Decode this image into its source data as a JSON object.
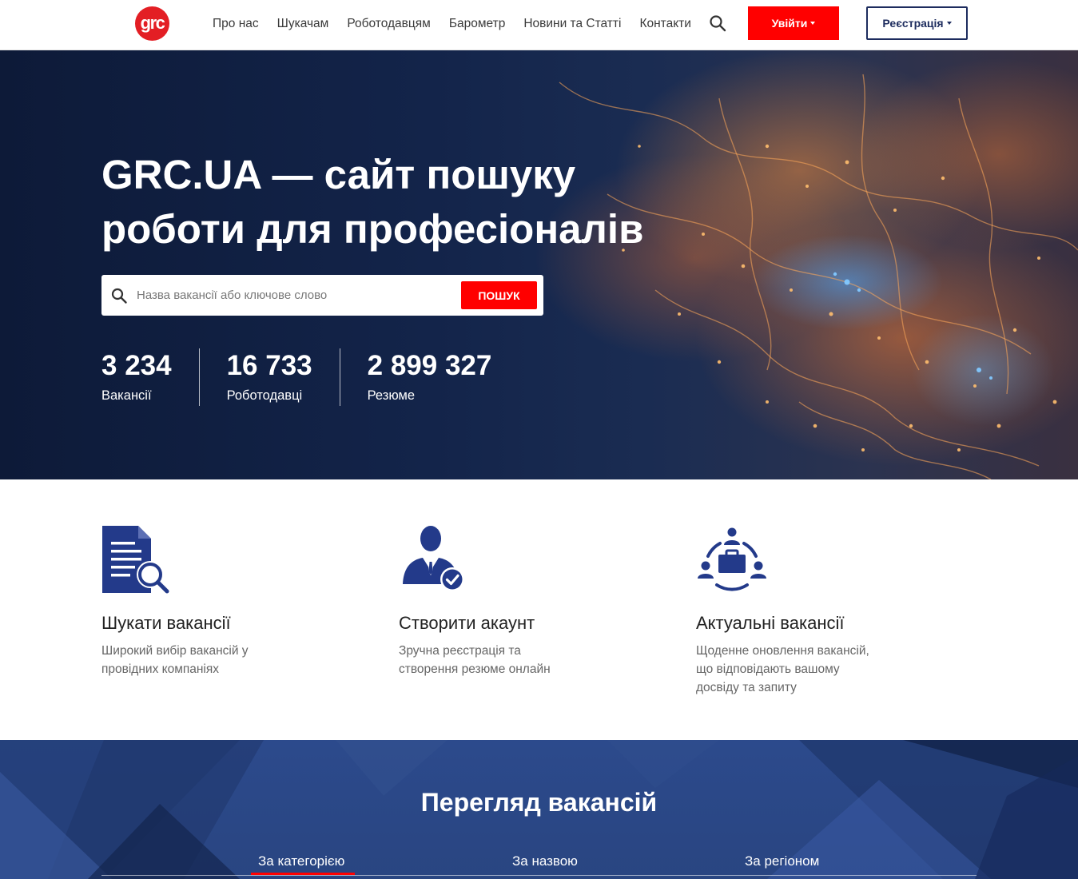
{
  "header": {
    "logo_text": "grc",
    "nav": [
      "Про нас",
      "Шукачам",
      "Роботодавцям",
      "Барометр",
      "Новини та Статті",
      "Контакти"
    ],
    "login_label": "Увійти",
    "register_label": "Реєстрація",
    "icons": {
      "search": "search-icon",
      "caret": "caret-down-icon"
    }
  },
  "hero": {
    "title_line1": "GRC.UA — сайт пошуку",
    "title_line2": "роботи для професіоналів",
    "search_placeholder": "Назва вакансії або ключове слово",
    "search_button": "ПОШУК",
    "stats": [
      {
        "value": "3 234",
        "label": "Вакансії"
      },
      {
        "value": "16 733",
        "label": "Роботодавці"
      },
      {
        "value": "2 899 327",
        "label": "Резюме"
      }
    ]
  },
  "features": [
    {
      "icon": "document-search-icon",
      "title": "Шукати вакансії",
      "desc_line1": "Широкий вибір вакансій у",
      "desc_line2": "провідних компаніях",
      "desc_line3": ""
    },
    {
      "icon": "user-check-icon",
      "title": "Створити акаунт",
      "desc_line1": "Зручна реєстрація та",
      "desc_line2": "створення резюме онлайн",
      "desc_line3": ""
    },
    {
      "icon": "team-briefcase-icon",
      "title": "Актуальні вакансії",
      "desc_line1": "Щоденне оновлення вакансій,",
      "desc_line2": "що відповідають вашому",
      "desc_line3": "досвіду та запиту"
    }
  ],
  "browse": {
    "title": "Перегляд вакансій",
    "tabs": [
      "За категорією",
      "За назвою",
      "За регіоном"
    ],
    "active_tab": "За категорією"
  },
  "colors": {
    "accent_red": "#ff0000",
    "brand_navy": "#1d2c5e",
    "icon_blue": "#233a8a"
  }
}
